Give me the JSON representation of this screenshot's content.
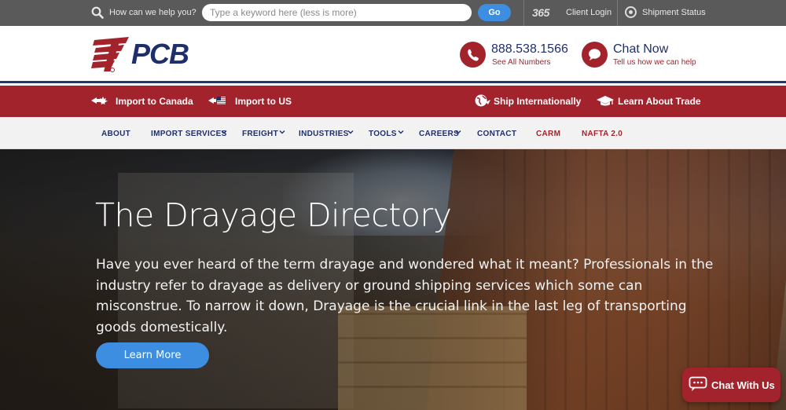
{
  "topbar": {
    "help_label": "How can we help you?",
    "search_placeholder": "Type a keyword here (less is more)",
    "go_label": "Go",
    "brand_365": "365",
    "client_login": "Client Login",
    "shipment_status": "Shipment Status"
  },
  "header": {
    "logo_text": "PCB",
    "phone_number": "888.538.1566",
    "phone_sub": "See All Numbers",
    "chat_title": "Chat Now",
    "chat_sub": "Tell us how we can help"
  },
  "redbar": {
    "import_canada": "Import to Canada",
    "import_us": "Import to US",
    "ship_internationally": "Ship Internationally",
    "learn_about_trade": "Learn About Trade"
  },
  "nav": {
    "items": [
      "ABOUT",
      "IMPORT SERVICES",
      "FREIGHT",
      "INDUSTRIES",
      "TOOLS",
      "CAREERS",
      "CONTACT",
      "CARM",
      "NAFTA 2.0"
    ]
  },
  "hero": {
    "title": "The Drayage Directory",
    "text": "Have you ever heard of the term drayage and wondered what it meant? Professionals in the industry refer to drayage as delivery or ground shipping services which some can misconstrue. To narrow it down, Drayage is the crucial link in the last leg of transporting goods domestically.",
    "button": "Learn More"
  },
  "chat_widget": {
    "label": "Chat With Us"
  },
  "colors": {
    "brand_red": "#a3232d",
    "brand_navy": "#1f2f6b",
    "accent_blue": "#3d8ee0",
    "topbar_gray": "#5a5a5a"
  }
}
